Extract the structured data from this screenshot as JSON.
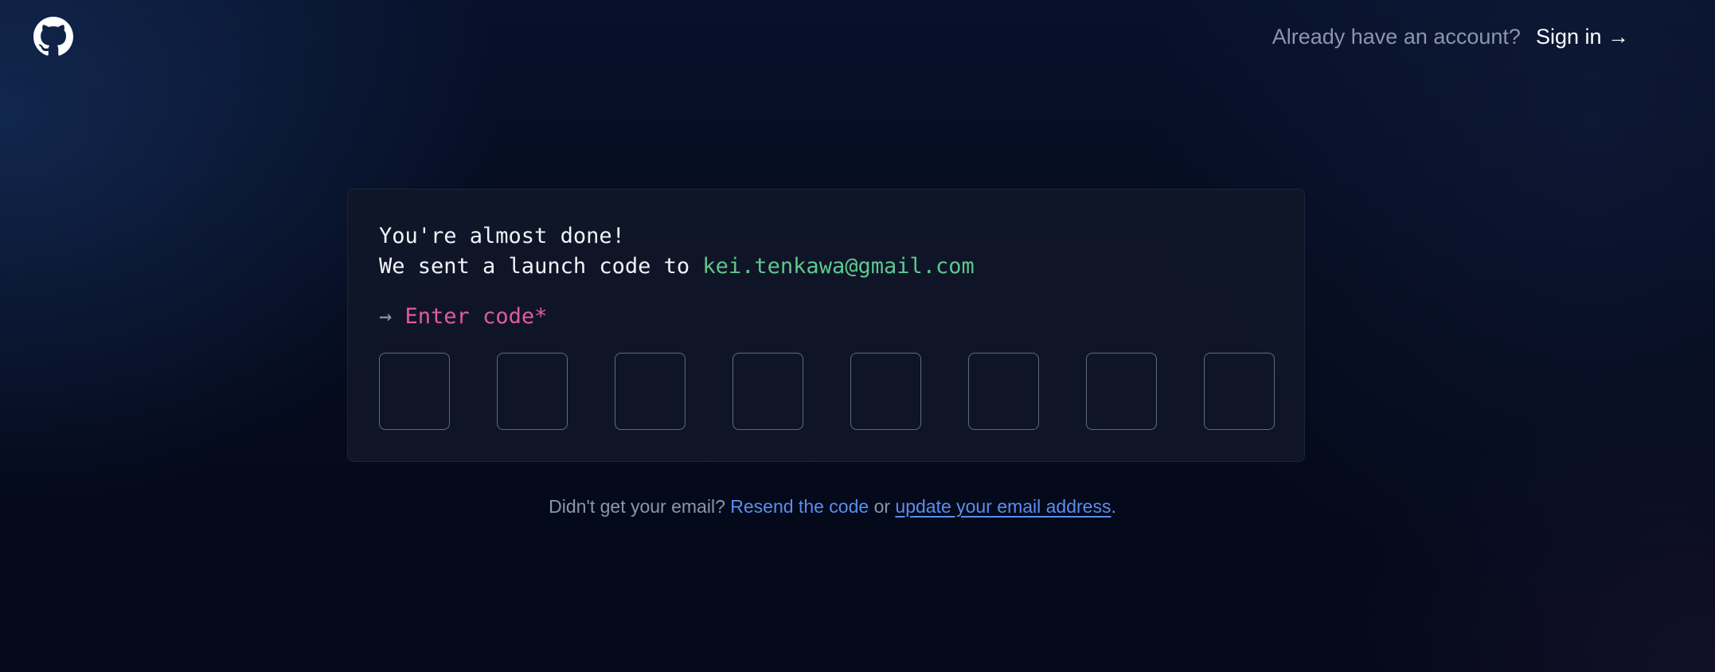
{
  "header": {
    "logo_icon": "github-logo-icon",
    "already_text": "Already have an account?",
    "signin_label": "Sign in →"
  },
  "card": {
    "heading": "You're almost done!",
    "sent_prefix": "We sent a launch code to ",
    "email": "kei.tenkawa@gmail.com",
    "prompt_arrow": "→",
    "code_label": "Enter code*",
    "code_boxes": [
      "",
      "",
      "",
      "",
      "",
      "",
      "",
      ""
    ]
  },
  "footer": {
    "prefix": "Didn't get your email?",
    "resend_label": "Resend the code",
    "or_text": "or",
    "update_label": "update your email address",
    "suffix": "."
  },
  "colors": {
    "background": "#050a1c",
    "card_background": "#101728",
    "email": "#5fc78f",
    "label": "#e35aa3",
    "link": "#5b8def",
    "muted_text": "#8b95ab"
  }
}
